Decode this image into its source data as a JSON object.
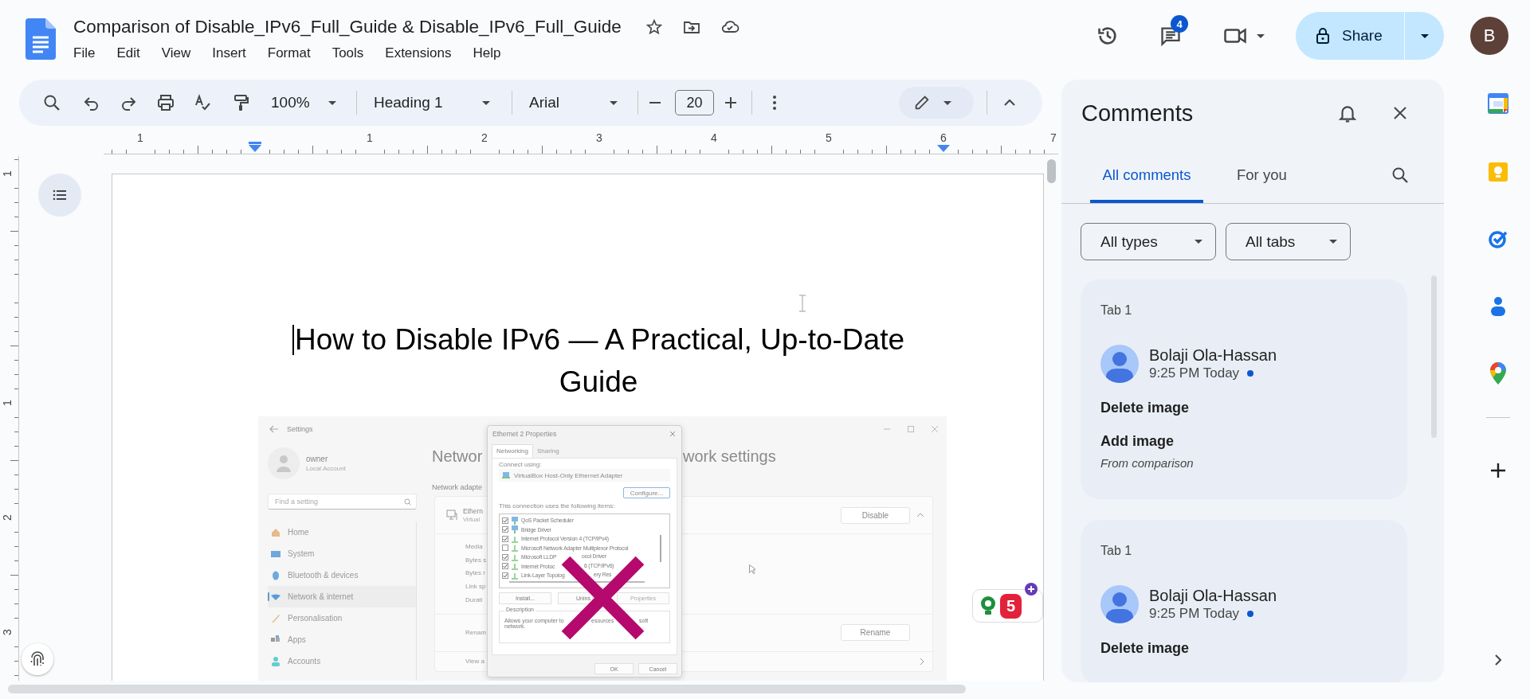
{
  "document_title": "Comparison of Disable_IPv6_Full_Guide & Disable_IPv6_Full_Guide",
  "menu": [
    "File",
    "Edit",
    "View",
    "Insert",
    "Format",
    "Tools",
    "Extensions",
    "Help"
  ],
  "header": {
    "comment_count": "4",
    "share_label": "Share",
    "avatar_letter": "B"
  },
  "toolbar": {
    "zoom": "100%",
    "paragraph_style": "Heading 1",
    "font": "Arial",
    "font_size": "20"
  },
  "ruler": {
    "numbers": [
      "1",
      "1",
      "2",
      "3",
      "4",
      "5",
      "6",
      "7"
    ]
  },
  "vertical_ruler": {
    "numbers": [
      "1",
      "1",
      "2",
      "3"
    ]
  },
  "page": {
    "heading": "How to Disable IPv6 — A Practical, Up-to-Date Guide",
    "embedded_screenshot": {
      "settings": {
        "title": "Settings",
        "account_name": "owner",
        "account_type": "Local Account",
        "search_placeholder": "Find a setting",
        "nav": [
          {
            "label": "Home",
            "selected": false
          },
          {
            "label": "System",
            "selected": false
          },
          {
            "label": "Bluetooth & devices",
            "selected": false
          },
          {
            "label": "Network & internet",
            "selected": true
          },
          {
            "label": "Personalisation",
            "selected": false
          },
          {
            "label": "Apps",
            "selected": false
          },
          {
            "label": "Accounts",
            "selected": false
          }
        ],
        "heading_start": "Networ",
        "heading_end": "work settings",
        "section_label": "Network adapte",
        "adapter_name": "Ethern",
        "adapter_description": "Virtual",
        "adapter_action": "Disable",
        "adapter_expanded": true,
        "details": [
          "Media",
          "Bytes s",
          "Bytes r",
          "Link sp",
          "Durati"
        ],
        "rows": [
          {
            "kind": "button",
            "label": "Renam",
            "action": "Rename"
          },
          {
            "kind": "link",
            "label": "View a"
          }
        ]
      },
      "dialog": {
        "title": "Ethernet 2 Properties",
        "tabs": [
          {
            "label": "Networking",
            "selected": true
          },
          {
            "label": "Sharing",
            "selected": false
          }
        ],
        "connect_label": "Connect using:",
        "adapter": "VirtualBox Host-Only Ethernet Adapter",
        "configure_button": "Configure...",
        "items_label": "This connection uses the following items:",
        "items": [
          {
            "kind": "service",
            "label": "QoS Packet Scheduler",
            "checked": true
          },
          {
            "kind": "service",
            "label": "Bridge Driver",
            "checked": true
          },
          {
            "kind": "protocol",
            "label": "Internet Protocol Version 4 (TCP/IPv4)",
            "checked": true
          },
          {
            "kind": "protocol",
            "label": "Microsoft Network Adapter Multiplexor Protocol",
            "checked": false
          },
          {
            "kind": "protocol",
            "label": "Microsoft LLDP",
            "label_end": "ocol Driver",
            "checked": true
          },
          {
            "kind": "protocol",
            "label": "Internet Protoc",
            "label_end": "6 (TCP/IPv6)",
            "checked": true
          },
          {
            "kind": "protocol",
            "label": "Link-Layer Topolog",
            "label_end": "ery Res",
            "checked": true
          }
        ],
        "buttons": [
          {
            "label": "Install...",
            "disabled": false
          },
          {
            "label": "Unins",
            "disabled": false
          },
          {
            "label": "Properties",
            "disabled": true
          }
        ],
        "description_label": "Description",
        "description_parts": [
          "Allows your computer to",
          "esources",
          "soft"
        ],
        "description_end": "network.",
        "ok": "OK",
        "cancel": "Cancel"
      }
    }
  },
  "suggestion_count": "5",
  "comments": {
    "title": "Comments",
    "tabs": [
      {
        "label": "All comments",
        "selected": true
      },
      {
        "label": "For you",
        "selected": false
      }
    ],
    "filters": [
      "All types",
      "All tabs"
    ],
    "threads": [
      {
        "tab": "Tab 1",
        "author": "Bolaji Ola-Hassan",
        "time": "9:25 PM Today",
        "unread": true,
        "lines": [
          {
            "kind": "change",
            "text": "Delete image"
          },
          {
            "kind": "change",
            "text": "Add image"
          },
          {
            "kind": "note",
            "text": "From comparison"
          }
        ]
      },
      {
        "tab": "Tab 1",
        "author": "Bolaji Ola-Hassan",
        "time": "9:25 PM Today",
        "unread": true,
        "lines": [
          {
            "kind": "change",
            "text": "Delete image"
          }
        ]
      }
    ]
  }
}
